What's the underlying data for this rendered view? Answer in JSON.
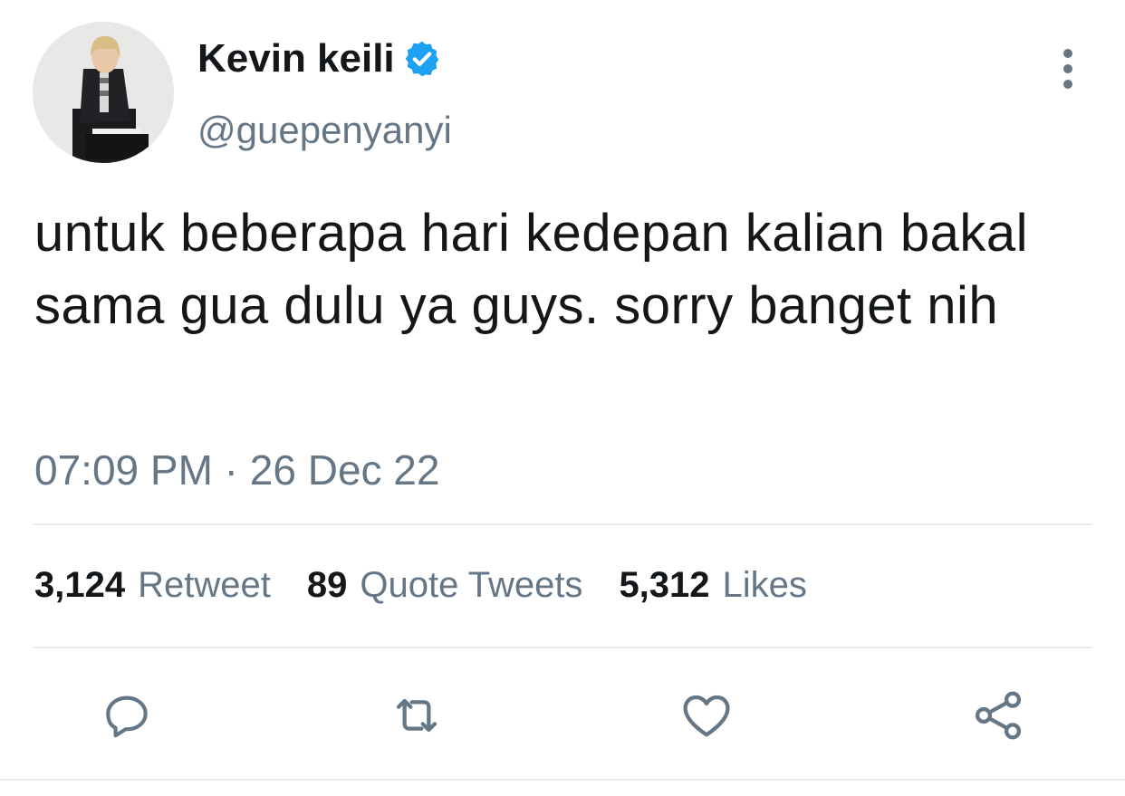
{
  "tweet": {
    "author": {
      "display_name": "Kevin keili",
      "handle": "@guepenyanyi",
      "verified": true
    },
    "text": "untuk beberapa hari kedepan kalian bakal sama gua dulu ya guys. sorry banget nih",
    "timestamp": "07:09 PM · 26 Dec 22",
    "stats": {
      "retweets_count": "3,124",
      "retweets_label": "Retweet",
      "quotes_count": "89",
      "quotes_label": "Quote Tweets",
      "likes_count": "5,312",
      "likes_label": "Likes"
    },
    "actions": {
      "reply": "reply-icon",
      "retweet": "retweet-icon",
      "like": "heart-icon",
      "share": "share-icon"
    }
  },
  "colors": {
    "text_primary": "#14171a",
    "text_secondary": "#657786",
    "verified_blue": "#1da1f2",
    "divider": "#e6ecf0"
  }
}
